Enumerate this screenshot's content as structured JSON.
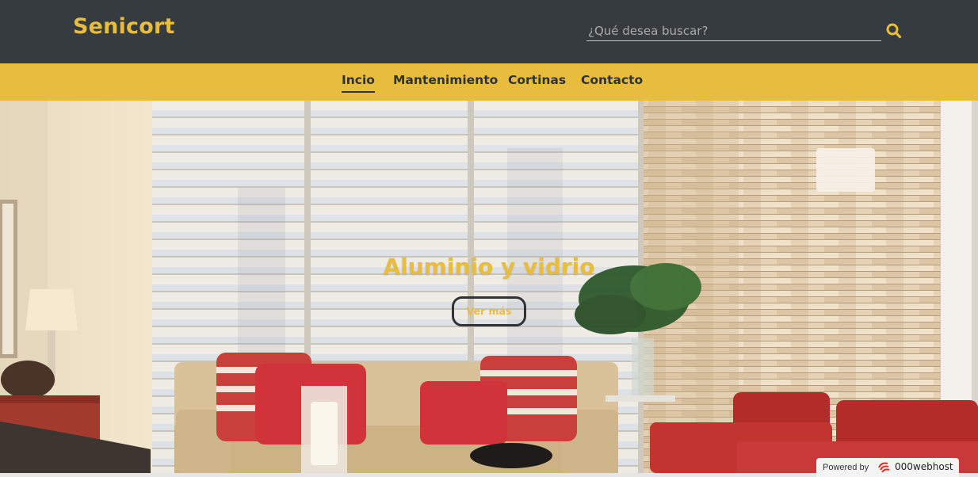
{
  "header": {
    "brand": "Senicort",
    "search": {
      "placeholder": "¿Qué desea buscar?",
      "value": ""
    },
    "search_icon": "search-icon"
  },
  "nav": {
    "items": [
      {
        "label": "Incio",
        "active": true
      },
      {
        "label": "Mantenimiento",
        "active": false
      },
      {
        "label": "Cortinas",
        "active": false
      },
      {
        "label": "Contacto",
        "active": false
      }
    ]
  },
  "hero": {
    "title": "Aluminio y vidrio",
    "button_label": "Ver más"
  },
  "footer_badge": {
    "powered_by": "Powered by",
    "brand": "000webhost",
    "logo_icon": "000webhost-logo-icon"
  },
  "colors": {
    "topbar": "#353b3f",
    "accent": "#e8bd3e",
    "nav_text": "#2f3336"
  }
}
